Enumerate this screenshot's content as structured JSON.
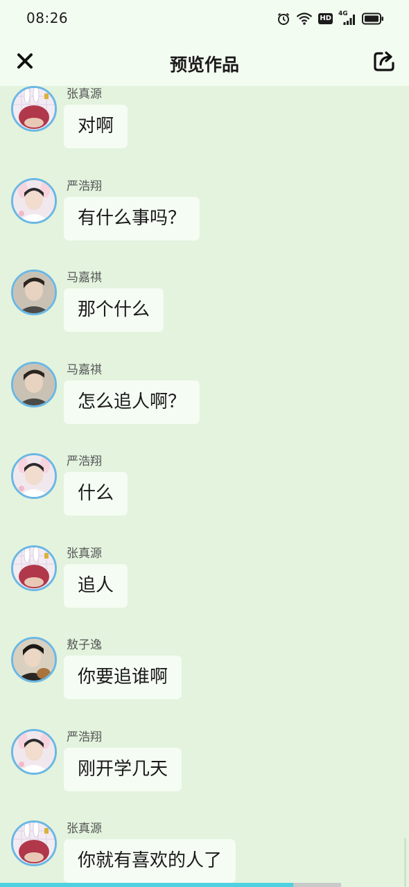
{
  "status_bar": {
    "time": "08:26",
    "badge_hd": "HD",
    "badge_network": "4G"
  },
  "header": {
    "title": "预览作品"
  },
  "messages": [
    {
      "sender": "张真源",
      "text": "对啊",
      "avatar": "zhang"
    },
    {
      "sender": "严浩翔",
      "text": "有什么事吗？",
      "avatar": "yan"
    },
    {
      "sender": "马嘉祺",
      "text": "那个什么",
      "avatar": "ma"
    },
    {
      "sender": "马嘉祺",
      "text": "怎么追人啊？",
      "avatar": "ma"
    },
    {
      "sender": "严浩翔",
      "text": "什么",
      "avatar": "yan"
    },
    {
      "sender": "张真源",
      "text": "追人",
      "avatar": "zhang"
    },
    {
      "sender": "敖子逸",
      "text": "你要追谁啊",
      "avatar": "ao"
    },
    {
      "sender": "严浩翔",
      "text": "刚开学几天",
      "avatar": "yan"
    },
    {
      "sender": "张真源",
      "text": "你就有喜欢的人了",
      "avatar": "zhang"
    }
  ],
  "playback_progress": 0.86,
  "colors": {
    "background": "#e3f3de",
    "header_bg": "#f3fcf1",
    "bubble_bg": "#f4fcf3",
    "avatar_border": "#6ab7e4",
    "progress_fill": "#4ed1e0"
  }
}
